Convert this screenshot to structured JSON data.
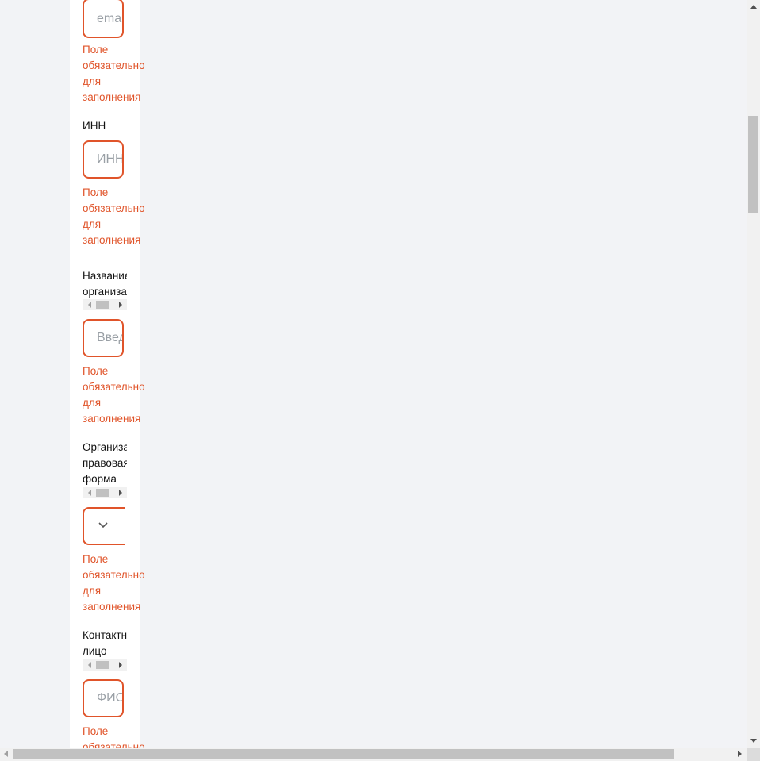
{
  "fields": {
    "email": {
      "placeholder": "email",
      "error": [
        "Поле",
        "обязательно",
        "для",
        "заполнения"
      ]
    },
    "inn": {
      "label": [
        "ИНН"
      ],
      "placeholder": "ИНН",
      "error": [
        "Поле",
        "обязательно",
        "для",
        "заполнения"
      ]
    },
    "org_name": {
      "label": [
        "Название",
        "организации"
      ],
      "placeholder": "Введите",
      "error": [
        "Поле",
        "обязательно",
        "для",
        "заполнения"
      ]
    },
    "legal_form": {
      "label": [
        "Организационно",
        "правовая",
        "форма"
      ],
      "selected": "",
      "icon": "chevron-down-icon",
      "error": [
        "Поле",
        "обязательно",
        "для",
        "заполнения"
      ]
    },
    "contact": {
      "label": [
        "Контактное",
        "лицо"
      ],
      "placeholder": "ФИО",
      "error": [
        "Поле",
        "обязательно"
      ]
    }
  },
  "colors": {
    "error": "#e0542a",
    "border": "#e0542a",
    "background": "#f2f3f6",
    "panel": "#ffffff"
  }
}
